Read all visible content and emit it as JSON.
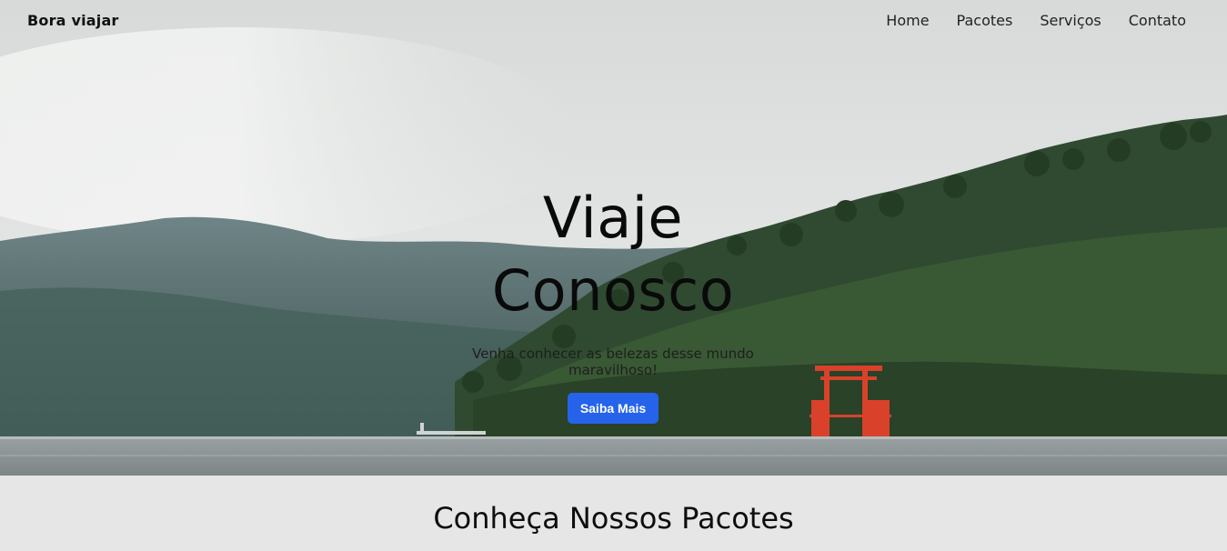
{
  "navbar": {
    "brand": "Bora viajar",
    "links": [
      "Home",
      "Pacotes",
      "Serviços",
      "Contato"
    ]
  },
  "hero": {
    "title_line1": "Viaje",
    "title_line2": "Conosco",
    "subtitle": "Venha conhecer as belezas desse mundo maravilhoso!",
    "cta_label": "Saiba Mais",
    "background": "misty-lake-forest-torii-photo"
  },
  "packages_section": {
    "title": "Conheça Nossos Pacotes"
  },
  "colors": {
    "accent": "#2563eb",
    "torii": "#d9412b",
    "section_bg": "#e6e6e6"
  }
}
